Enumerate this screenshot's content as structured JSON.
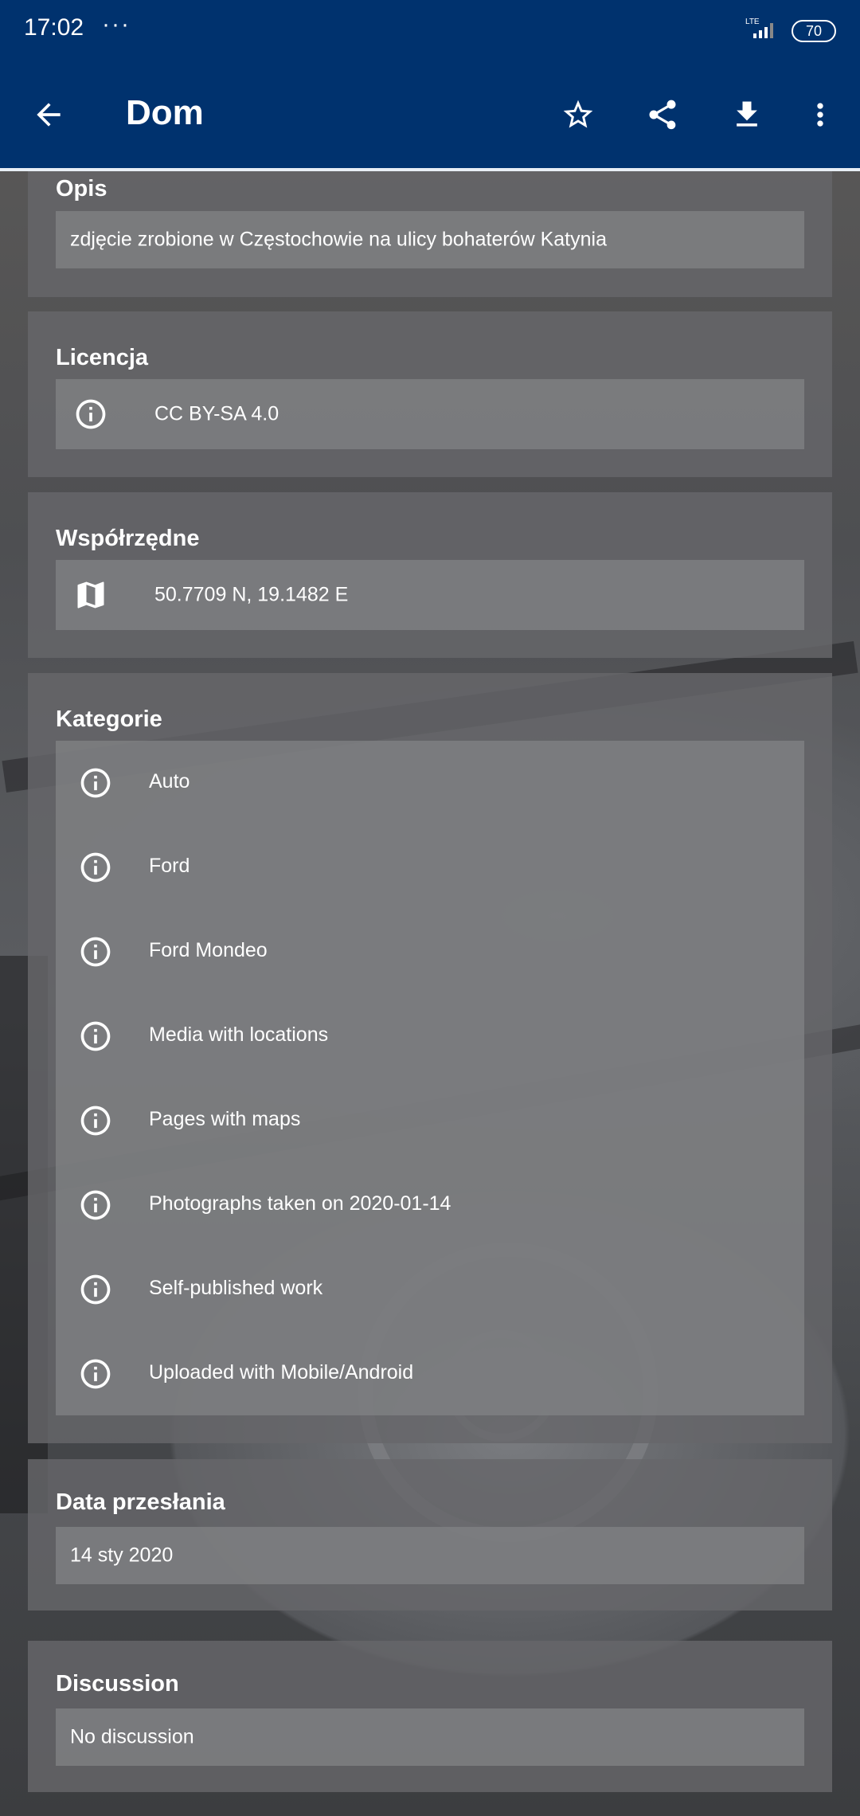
{
  "status_bar": {
    "time": "17:02",
    "dots": "···",
    "network": "LTE",
    "battery": "70"
  },
  "app_bar": {
    "title": "Dom"
  },
  "description": {
    "heading": "Opis",
    "text": "zdjęcie zrobione w Częstochowie na ulicy bohaterów Katynia"
  },
  "license": {
    "heading": "Licencja",
    "value": "CC BY-SA 4.0"
  },
  "coordinates": {
    "heading": "Współrzędne",
    "value": "50.7709 N, 19.1482 E"
  },
  "categories": {
    "heading": "Kategorie",
    "items": [
      "Auto",
      "Ford",
      "Ford Mondeo",
      "Media with locations",
      "Pages with maps",
      "Photographs taken on 2020-01-14",
      "Self-published work",
      "Uploaded with Mobile/Android"
    ]
  },
  "upload_date": {
    "heading": "Data przesłania",
    "value": "14 sty 2020"
  },
  "discussion": {
    "heading": "Discussion",
    "value": "No discussion"
  }
}
